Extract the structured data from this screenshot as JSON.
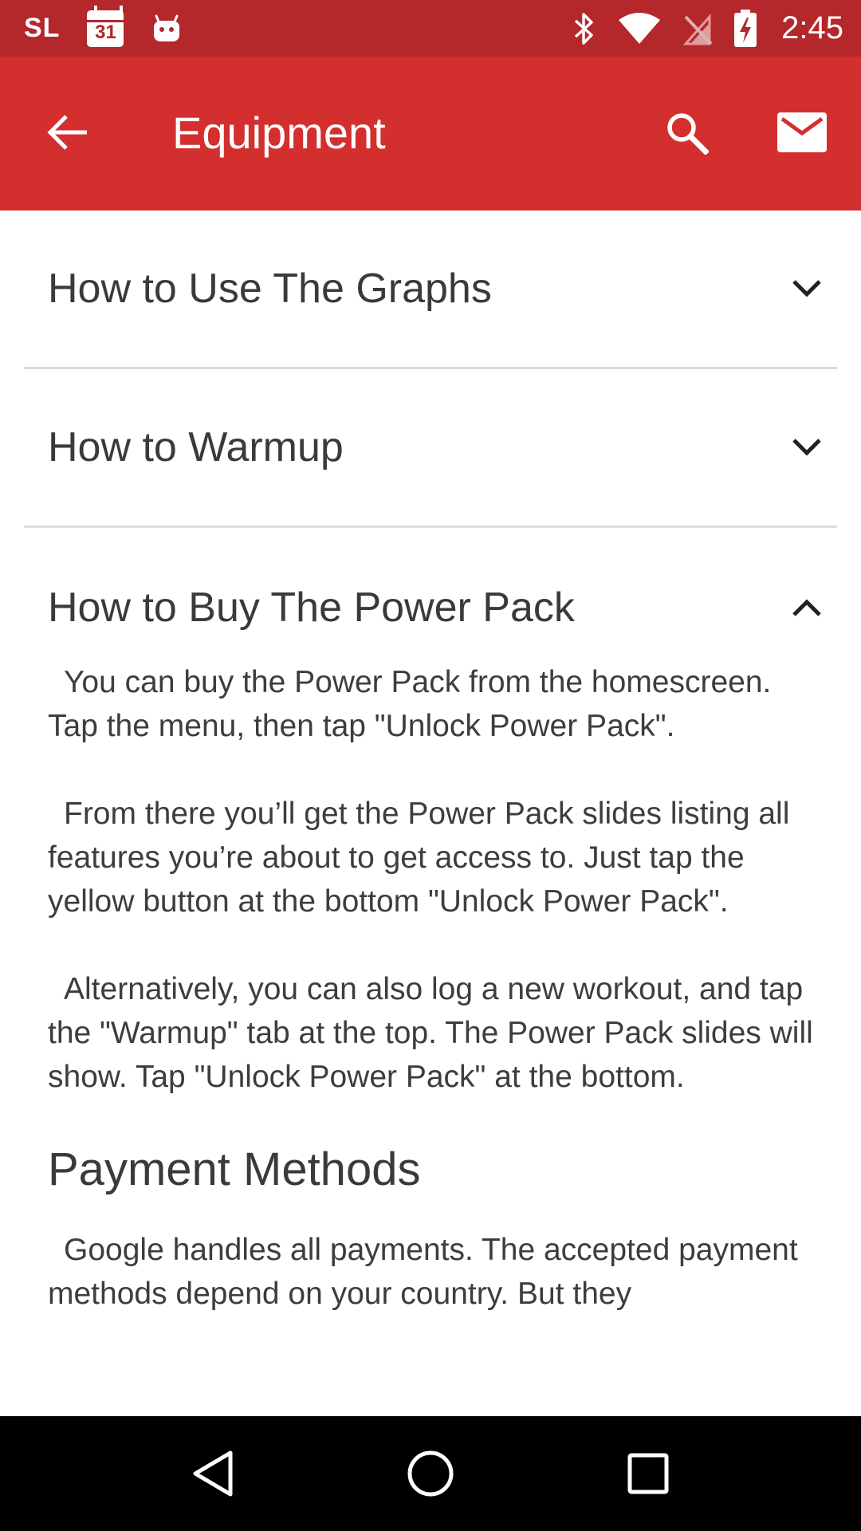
{
  "status_bar": {
    "carrier": "SL",
    "calendar_day": "31",
    "time": "2:45"
  },
  "app_bar": {
    "title": "Equipment"
  },
  "accordion": [
    {
      "title": "How to Use The Graphs",
      "expanded": false
    },
    {
      "title": "How to Warmup",
      "expanded": false
    },
    {
      "title": "How to Buy The Power Pack",
      "expanded": true,
      "paragraphs": [
        "You can buy the Power Pack from the homescreen. Tap the menu, then tap \"Unlock Power Pack\".",
        "From there you’ll get the Power Pack slides listing all features you’re about to get access to. Just tap the yellow button at the bottom \"Unlock Power Pack\".",
        "Alternatively, you can also log a new workout, and tap the \"Warmup\" tab at the top. The Power Pack slides will show. Tap \"Unlock Power Pack\" at the bottom."
      ],
      "section_heading": "Payment Methods",
      "section_paragraph": "Google handles all payments. The accepted payment methods depend on your country. But they"
    }
  ],
  "colors": {
    "status_bar": "#b4272a",
    "app_bar": "#d32f2f",
    "text": "#3a3a3a"
  }
}
